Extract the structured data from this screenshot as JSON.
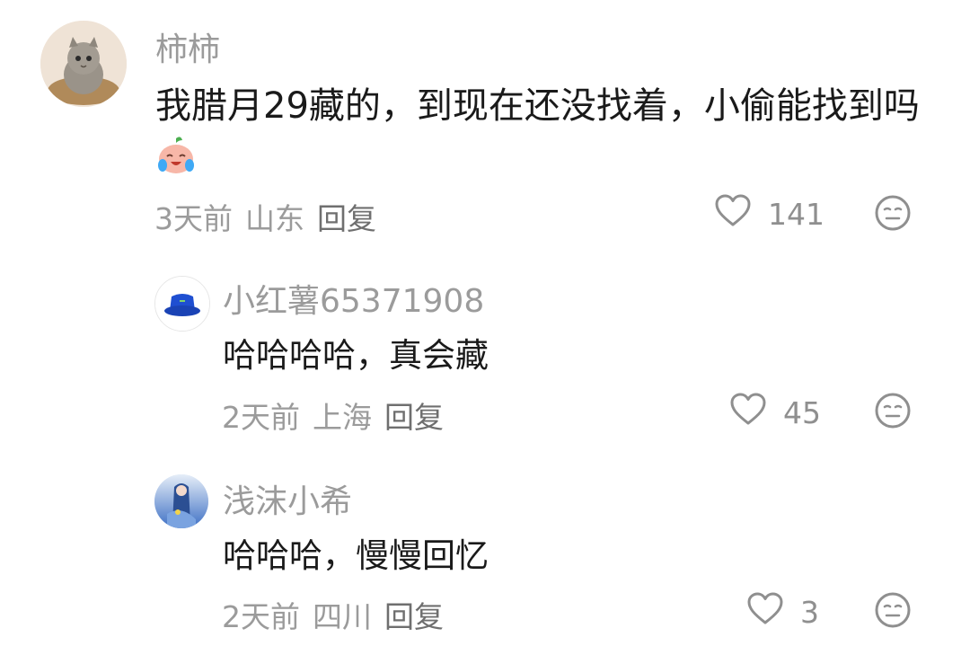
{
  "comments": [
    {
      "username": "柿柿",
      "text": "我腊月29藏的，到现在还没找着，小偷能找到吗",
      "time": "3天前",
      "location": "山东",
      "reply_label": "回复",
      "likes": "141",
      "emoji": "crying-laughing-peach-emoji"
    },
    {
      "username": "小红薯65371908",
      "text": "哈哈哈哈，真会藏",
      "time": "2天前",
      "location": "上海",
      "reply_label": "回复",
      "likes": "45"
    },
    {
      "username": "浅沫小希",
      "text": "哈哈哈，慢慢回忆",
      "time": "2天前",
      "location": "四川",
      "reply_label": "回复",
      "likes": "3"
    }
  ],
  "colors": {
    "meta_gray": "#9b9b9b",
    "text_dark": "#1a1a1a",
    "hat_blue": "#1f4fd1"
  },
  "icons": [
    "heart-icon",
    "neutral-face-icon"
  ]
}
